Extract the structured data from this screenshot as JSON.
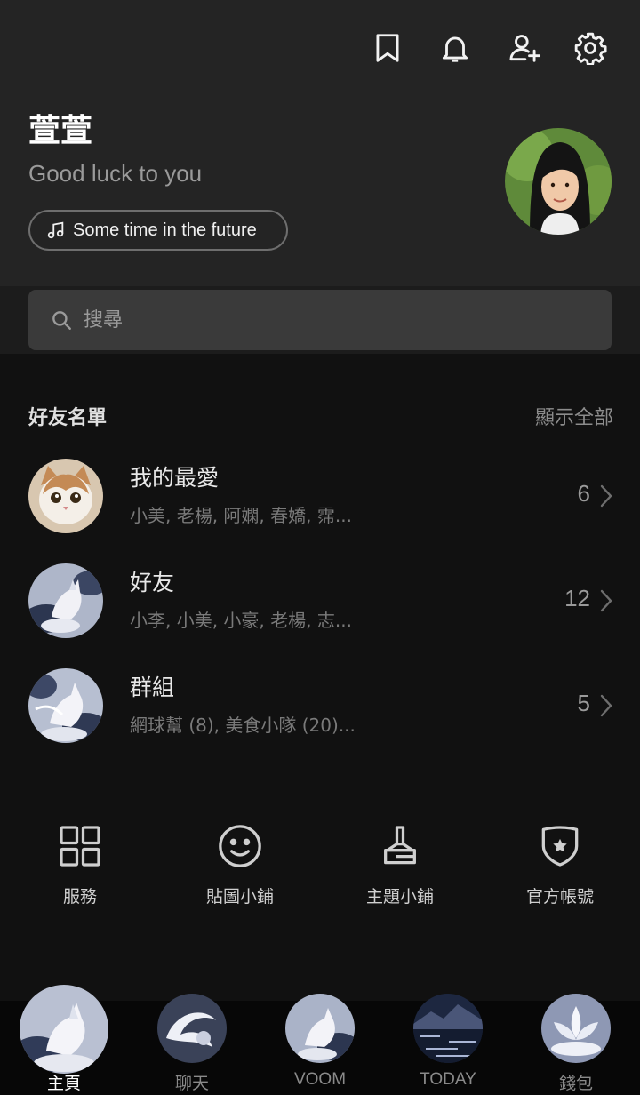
{
  "header": {
    "icons": [
      "bookmark-icon",
      "bell-icon",
      "add-friend-icon",
      "gear-icon"
    ],
    "name": "萱萱",
    "status": "Good luck to you",
    "music": "Some time in the future"
  },
  "search": {
    "placeholder": "搜尋"
  },
  "friends": {
    "title": "好友名單",
    "show_all": "顯示全部",
    "rows": [
      {
        "title": "我的最愛",
        "subtitle": "小美, 老楊, 阿嫻, 春嬌, 霈...",
        "count": "6",
        "avatar": "cat-photo"
      },
      {
        "title": "好友",
        "subtitle": "小李, 小美, 小豪, 老楊, 志...",
        "count": "12",
        "avatar": "fox-art"
      },
      {
        "title": "群組",
        "subtitle": "網球幫 (8), 美食小隊 (20)...",
        "count": "5",
        "avatar": "fox-art"
      }
    ]
  },
  "services": [
    {
      "label": "服務",
      "icon": "grid-icon"
    },
    {
      "label": "貼圖小鋪",
      "icon": "smiley-icon"
    },
    {
      "label": "主題小鋪",
      "icon": "brush-icon"
    },
    {
      "label": "官方帳號",
      "icon": "shield-star-icon"
    }
  ],
  "bottom_nav": [
    {
      "label": "主頁",
      "active": true
    },
    {
      "label": "聊天",
      "active": false
    },
    {
      "label": "VOOM",
      "active": false
    },
    {
      "label": "TODAY",
      "active": false
    },
    {
      "label": "錢包",
      "active": false
    }
  ]
}
